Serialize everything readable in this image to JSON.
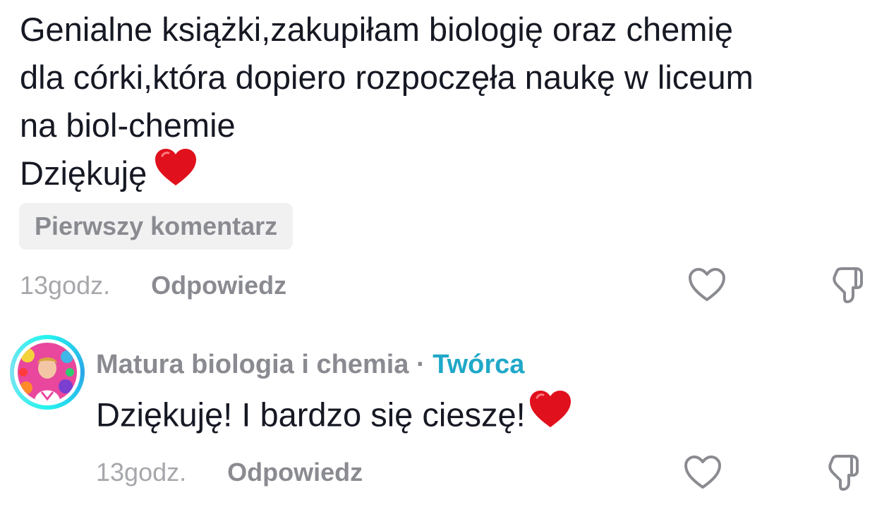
{
  "comment": {
    "lines": [
      "Genialne książki,zakupiłam biologię oraz chemię",
      "dla córki,która dopiero rozpoczęła naukę w liceum",
      "na biol-chemie",
      "Dziękuję"
    ],
    "emoji": "red-heart",
    "badge": "Pierwszy komentarz",
    "time": "13godz.",
    "reply_label": "Odpowiedz"
  },
  "reply": {
    "author": "Matura biologia i chemia",
    "separator": " · ",
    "role": "Twórca",
    "text": "Dziękuję! I bardzo się cieszę!",
    "emoji": "red-heart",
    "time": "13godz.",
    "reply_label": "Odpowiedz"
  },
  "colors": {
    "text": "#161823",
    "muted": "#8a8b91",
    "creator": "#20a8c8",
    "heart": "#e0101c"
  }
}
